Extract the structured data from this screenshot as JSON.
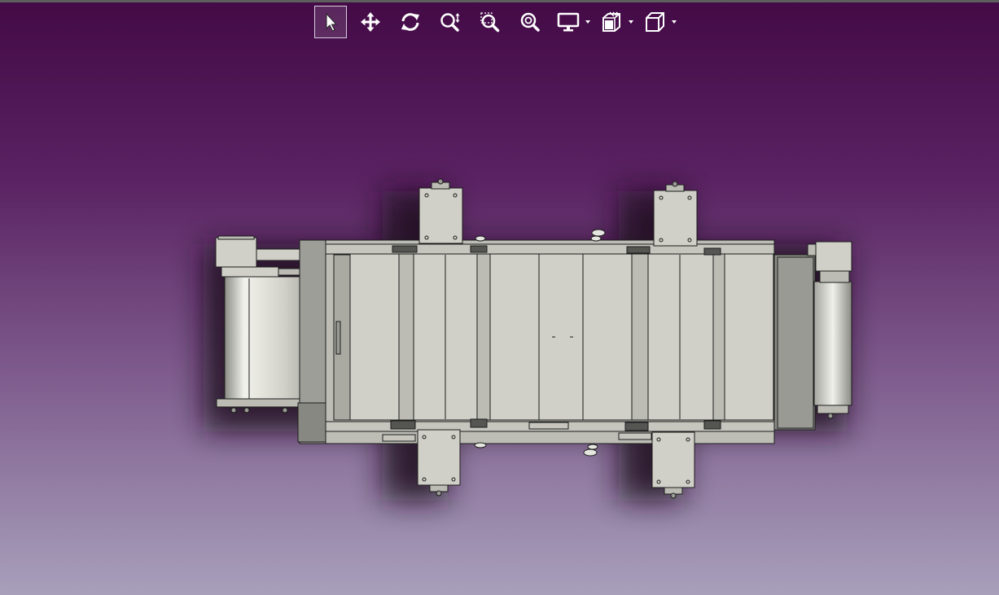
{
  "toolbar": {
    "tools": [
      {
        "id": "select",
        "icon": "pointer-arrow-icon",
        "active": true
      },
      {
        "id": "pan",
        "icon": "move-arrows-icon",
        "active": false
      },
      {
        "id": "rotate",
        "icon": "rotate-icon",
        "active": false
      },
      {
        "id": "zoom",
        "icon": "zoom-updown-icon",
        "active": false
      },
      {
        "id": "zoom-window",
        "icon": "zoom-window-icon",
        "active": false
      },
      {
        "id": "zoom-fit",
        "icon": "zoom-fit-icon",
        "active": false
      }
    ],
    "dropdowns": [
      {
        "id": "display",
        "icon": "monitor-icon"
      },
      {
        "id": "section",
        "icon": "section-plane-icon"
      },
      {
        "id": "view",
        "icon": "cube-view-icon"
      }
    ]
  },
  "viewport": {
    "background_top": "#430a46",
    "background_bottom": "#a8a0bb",
    "model_color": "#d0d0c8",
    "model_dark": "#8a8a85",
    "model": "conveyor-oven-assembly"
  }
}
